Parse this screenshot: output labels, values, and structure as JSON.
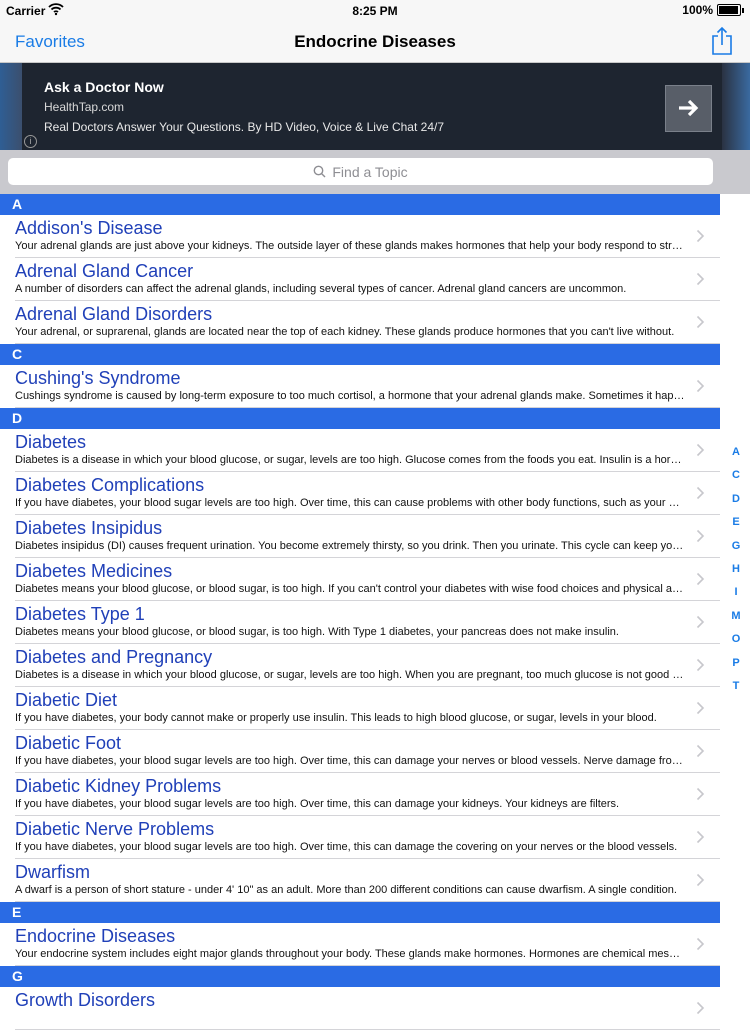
{
  "status_bar": {
    "carrier": "Carrier",
    "time": "8:25 PM",
    "battery": "100%"
  },
  "nav": {
    "back_label": "Favorites",
    "title": "Endocrine Diseases",
    "share_icon": "share-icon"
  },
  "ad": {
    "title": "Ask a Doctor Now",
    "url": "HealthTap.com",
    "description": "Real Doctors Answer Your Questions. By HD Video, Voice & Live Chat 24/7",
    "button_icon": "arrow-right-icon",
    "info_glyph": "i"
  },
  "search": {
    "placeholder": "Find a Topic"
  },
  "sections": [
    {
      "letter": "A",
      "items": [
        {
          "title": "Addison's Disease",
          "subtitle": "Your adrenal glands are just above your kidneys. The outside layer of these glands makes hormones that help your body respond to stress."
        },
        {
          "title": "Adrenal Gland Cancer",
          "subtitle": "A number of disorders can affect the adrenal glands, including several types of cancer. Adrenal gland cancers are uncommon."
        },
        {
          "title": "Adrenal Gland Disorders",
          "subtitle": "Your adrenal, or suprarenal, glands are located near the top of each kidney. These glands produce hormones that you can't live without."
        }
      ]
    },
    {
      "letter": "C",
      "items": [
        {
          "title": "Cushing's Syndrome",
          "subtitle": "Cushings syndrome is caused by long-term exposure to too much cortisol, a hormone that your adrenal glands make. Sometimes it happens."
        }
      ]
    },
    {
      "letter": "D",
      "items": [
        {
          "title": "Diabetes",
          "subtitle": "Diabetes is a disease in which your blood glucose, or sugar, levels are too high. Glucose comes from the foods you eat. Insulin is a hormone."
        },
        {
          "title": "Diabetes Complications",
          "subtitle": "If you have diabetes, your blood sugar levels are too high. Over time, this can cause problems with other body functions, such as your kidneys."
        },
        {
          "title": "Diabetes Insipidus",
          "subtitle": "Diabetes insipidus (DI) causes frequent urination. You become extremely thirsty, so you drink. Then you urinate. This cycle can keep you from sleeping."
        },
        {
          "title": "Diabetes Medicines",
          "subtitle": "Diabetes means your blood glucose, or blood sugar, is too high. If you can't control your diabetes with wise food choices and physical activity."
        },
        {
          "title": "Diabetes Type 1",
          "subtitle": "Diabetes means your blood glucose, or blood sugar, is too high. With Type 1 diabetes, your pancreas does not make insulin."
        },
        {
          "title": "Diabetes and Pregnancy",
          "subtitle": "Diabetes is a disease in which your blood glucose, or sugar, levels are too high. When you are pregnant, too much glucose is not good for your baby."
        },
        {
          "title": "Diabetic Diet",
          "subtitle": "If you have diabetes, your body cannot make or properly use insulin. This leads to high blood glucose, or sugar, levels in your blood."
        },
        {
          "title": "Diabetic Foot",
          "subtitle": "If you have diabetes, your blood sugar levels are too high. Over time, this can damage your nerves or blood vessels. Nerve damage from diabetes."
        },
        {
          "title": "Diabetic Kidney Problems",
          "subtitle": "If you have diabetes, your blood sugar levels are too high. Over time, this can damage your kidneys. Your kidneys are filters."
        },
        {
          "title": "Diabetic Nerve Problems",
          "subtitle": "If you have diabetes, your blood sugar levels are too high. Over time, this can damage the covering on your nerves or the blood vessels."
        },
        {
          "title": "Dwarfism",
          "subtitle": "A dwarf is a person of short stature - under 4' 10\" as an adult. More than 200 different conditions can cause dwarfism. A single condition."
        }
      ]
    },
    {
      "letter": "E",
      "items": [
        {
          "title": "Endocrine Diseases",
          "subtitle": "Your endocrine system includes eight major glands throughout your body. These glands make hormones. Hormones are chemical messengers."
        }
      ]
    },
    {
      "letter": "G",
      "items": [
        {
          "title": "Growth Disorders",
          "subtitle": ""
        }
      ]
    }
  ],
  "index_letters": [
    "A",
    "C",
    "D",
    "E",
    "G",
    "H",
    "I",
    "M",
    "O",
    "P",
    "T"
  ]
}
